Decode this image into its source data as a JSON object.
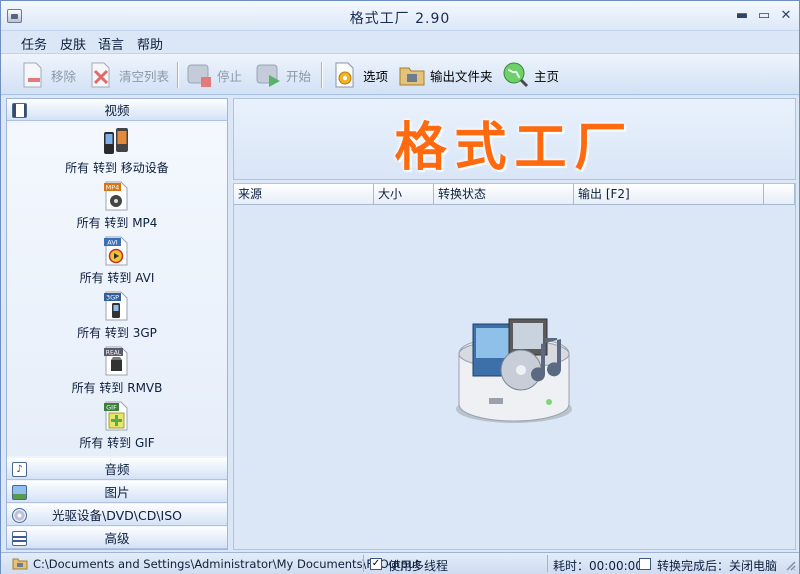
{
  "window": {
    "title": "格式工厂 2.90"
  },
  "menu": {
    "items": [
      "任务",
      "皮肤",
      "语言",
      "帮助"
    ]
  },
  "toolbar": {
    "remove": "移除",
    "clear_list": "清空列表",
    "stop": "停止",
    "start": "开始",
    "options": "选项",
    "output_folder": "输出文件夹",
    "home": "主页"
  },
  "categories": {
    "video": "视频",
    "audio": "音频",
    "image": "图片",
    "disc": "光驱设备\\DVD\\CD\\ISO",
    "advanced": "高级"
  },
  "video_items": [
    {
      "label": "所有 转到 移动设备",
      "icon": "mobile-device-icon"
    },
    {
      "label": "所有 转到 MP4",
      "icon": "mp4-file-icon",
      "badge": "MP4"
    },
    {
      "label": "所有 转到 AVI",
      "icon": "avi-file-icon",
      "badge": "AVI"
    },
    {
      "label": "所有 转到 3GP",
      "icon": "3gp-file-icon",
      "badge": "3GP"
    },
    {
      "label": "所有 转到 RMVB",
      "icon": "rmvb-file-icon",
      "badge": "REAL"
    },
    {
      "label": "所有 转到 GIF",
      "icon": "gif-file-icon",
      "badge": "GIF"
    }
  ],
  "banner": {
    "title": "格式工厂"
  },
  "columns": [
    "来源",
    "大小",
    "转换状态",
    "输出 [F2]"
  ],
  "status": {
    "output_path": "C:\\Documents and Settings\\Administrator\\My Documents\\FFOutput",
    "multithread_label": "使用多线程",
    "multithread_checked": "✓",
    "elapsed": "耗时：00:00:00",
    "after_convert": "转换完成后：关闭电脑"
  },
  "colors": {
    "banner_text": "#ff6a10",
    "window_bg": "#dbe7f7"
  }
}
